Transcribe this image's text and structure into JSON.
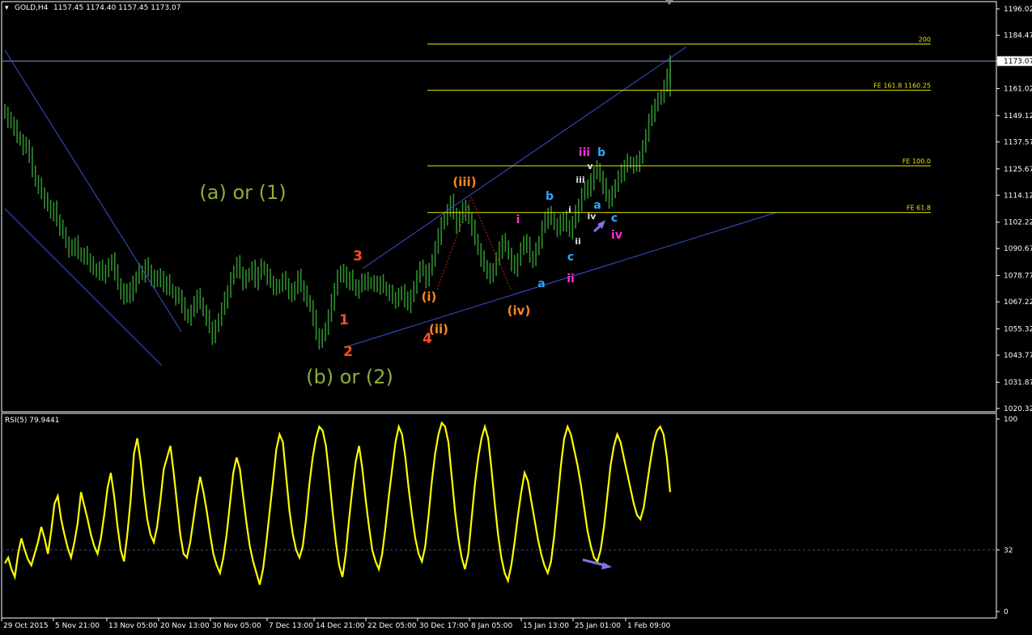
{
  "header": {
    "symbol": "GOLD,H4",
    "ohlc": "1157.45 1174.40 1157.45 1173.07",
    "rsi_label": "RSI(5) 79.9441"
  },
  "colors": {
    "background": "#000000",
    "frame": "#ffffff",
    "candles": "#2f8f2f",
    "channel": "#3a4fd6",
    "fib": "#e6e600",
    "rsi": "#ffff00",
    "price_line": "#8088b8",
    "arrow": "#7b77e6"
  },
  "chart_data": [
    {
      "type": "line",
      "name": "price",
      "y_ticks": [
        "1196.02",
        "1184.47",
        "1173.07",
        "1161.02",
        "1149.12",
        "1137.57",
        "1125.67",
        "1114.12",
        "1102.22",
        "1090.67",
        "1078.77",
        "1067.22",
        "1055.32",
        "1043.77",
        "1031.87",
        "1020.32"
      ],
      "ylim": [
        1020.32,
        1196.02
      ],
      "x_ticks": [
        "29 Oct 2015",
        "5 Nov 21:00",
        "13 Nov 05:00",
        "20 Nov 13:00",
        "30 Nov 05:00",
        "7 Dec 13:00",
        "14 Dec 21:00",
        "22 Dec 05:00",
        "30 Dec 17:00",
        "8 Jan 05:00",
        "15 Jan 13:00",
        "25 Jan 01:00",
        "1 Feb 09:00"
      ],
      "current_price": 1173.07,
      "close": [
        1150,
        1147,
        1146,
        1144,
        1140,
        1138,
        1135,
        1136,
        1132,
        1125,
        1120,
        1118,
        1115,
        1112,
        1110,
        1106,
        1108,
        1103,
        1100,
        1098,
        1093,
        1090,
        1091,
        1093,
        1089,
        1087,
        1088,
        1086,
        1084,
        1082,
        1080,
        1082,
        1079,
        1081,
        1083,
        1086,
        1080,
        1075,
        1072,
        1069,
        1073,
        1070,
        1075,
        1078,
        1081,
        1079,
        1083,
        1081,
        1078,
        1076,
        1079,
        1077,
        1074,
        1076,
        1073,
        1071,
        1069,
        1070,
        1066,
        1062,
        1060,
        1063,
        1066,
        1070,
        1067,
        1063,
        1060,
        1056,
        1052,
        1056,
        1060,
        1064,
        1068,
        1072,
        1077,
        1081,
        1084,
        1080,
        1076,
        1078,
        1080,
        1082,
        1076,
        1080,
        1083,
        1081,
        1078,
        1076,
        1074,
        1073,
        1075,
        1077,
        1075,
        1072,
        1070,
        1074,
        1078,
        1074,
        1071,
        1068,
        1065,
        1060,
        1053,
        1050,
        1052,
        1056,
        1061,
        1067,
        1073,
        1078,
        1081,
        1079,
        1076,
        1078,
        1075,
        1072,
        1074,
        1076,
        1077,
        1075,
        1076,
        1075,
        1074,
        1076,
        1074,
        1072,
        1071,
        1069,
        1068,
        1070,
        1072,
        1068,
        1066,
        1070,
        1073,
        1079,
        1082,
        1081,
        1077,
        1081,
        1086,
        1091,
        1096,
        1102,
        1103,
        1108,
        1111,
        1106,
        1101,
        1104,
        1109,
        1106,
        1104,
        1100,
        1095,
        1090,
        1086,
        1083,
        1081,
        1078,
        1082,
        1086,
        1090,
        1094,
        1092,
        1088,
        1084,
        1082,
        1086,
        1090,
        1094,
        1092,
        1087,
        1086,
        1090,
        1094,
        1100,
        1103,
        1106,
        1104,
        1101,
        1099,
        1102,
        1104,
        1101,
        1098,
        1102,
        1106,
        1110,
        1114,
        1118,
        1116,
        1120,
        1124,
        1126,
        1122,
        1118,
        1114,
        1112,
        1115,
        1119,
        1122,
        1124,
        1127,
        1129,
        1128,
        1127,
        1128,
        1131,
        1135,
        1141,
        1147,
        1150,
        1154,
        1156,
        1158,
        1162,
        1166,
        1173.07
      ]
    },
    {
      "type": "line",
      "name": "RSI(5)",
      "ylim": [
        0,
        100
      ],
      "y_ticks": [
        "100",
        "32",
        "0"
      ],
      "level": 32,
      "values": [
        25,
        28,
        22,
        18,
        30,
        38,
        32,
        27,
        24,
        30,
        36,
        44,
        38,
        30,
        42,
        56,
        60,
        48,
        40,
        33,
        28,
        36,
        46,
        62,
        55,
        48,
        40,
        34,
        30,
        38,
        50,
        64,
        72,
        60,
        45,
        32,
        26,
        40,
        58,
        82,
        90,
        78,
        62,
        48,
        40,
        36,
        44,
        58,
        74,
        80,
        86,
        72,
        56,
        40,
        30,
        28,
        36,
        48,
        60,
        70,
        62,
        52,
        40,
        30,
        24,
        20,
        28,
        40,
        56,
        72,
        80,
        74,
        60,
        46,
        34,
        26,
        20,
        14,
        22,
        36,
        52,
        68,
        84,
        92,
        88,
        70,
        52,
        40,
        32,
        28,
        34,
        48,
        66,
        80,
        90,
        96,
        94,
        86,
        70,
        52,
        36,
        24,
        18,
        30,
        48,
        64,
        78,
        86,
        74,
        58,
        44,
        32,
        26,
        22,
        30,
        44,
        60,
        74,
        88,
        96,
        92,
        80,
        64,
        50,
        38,
        30,
        26,
        34,
        50,
        68,
        82,
        92,
        98,
        96,
        88,
        70,
        52,
        38,
        28,
        22,
        30,
        48,
        66,
        80,
        90,
        96,
        90,
        74,
        56,
        40,
        28,
        20,
        16,
        24,
        36,
        50,
        62,
        72,
        68,
        58,
        48,
        38,
        30,
        24,
        20,
        26,
        40,
        58,
        76,
        90,
        96,
        92,
        84,
        76,
        66,
        54,
        42,
        34,
        28,
        26,
        32,
        44,
        60,
        76,
        86,
        92,
        88,
        80,
        72,
        64,
        56,
        50,
        48,
        54,
        66,
        78,
        88,
        94,
        96,
        92,
        80,
        62
      ]
    }
  ],
  "levels": [
    {
      "label": "200",
      "value": 1180.6
    },
    {
      "label": "FE 161.8 1160.25",
      "value": 1160.25
    },
    {
      "label": "FE 100.0",
      "value": 1127.0
    },
    {
      "label": "FE 61.8",
      "value": 1106.5
    }
  ],
  "annotations": [
    {
      "text": "(a) or (1)",
      "color": "#8fae3a",
      "size": "big"
    },
    {
      "text": "(b) or (2)",
      "color": "#8fae3a",
      "size": "big"
    },
    {
      "text": "1",
      "color": "#ff4e1e"
    },
    {
      "text": "2",
      "color": "#ff4e1e"
    },
    {
      "text": "3",
      "color": "#ff4e1e"
    },
    {
      "text": "4",
      "color": "#ff4e1e"
    },
    {
      "text": "(i)",
      "color": "#ff8a1e"
    },
    {
      "text": "(ii)",
      "color": "#ff8a1e"
    },
    {
      "text": "(iii)",
      "color": "#ff8a1e"
    },
    {
      "text": "(iv)",
      "color": "#ff8a1e"
    },
    {
      "text": "i",
      "color": "#ff2fd6"
    },
    {
      "text": "ii",
      "color": "#ff2fd6"
    },
    {
      "text": "iii",
      "color": "#ff2fd6"
    },
    {
      "text": "iv",
      "color": "#ff2fd6"
    },
    {
      "text": "a",
      "color": "#2aa8ff"
    },
    {
      "text": "b",
      "color": "#2aa8ff"
    },
    {
      "text": "c",
      "color": "#2aa8ff"
    },
    {
      "text": "b",
      "color": "#2aa8ff"
    },
    {
      "text": "a",
      "color": "#2aa8ff"
    },
    {
      "text": "c",
      "color": "#2aa8ff"
    },
    {
      "text": "i",
      "color": "#dddddd"
    },
    {
      "text": "ii",
      "color": "#dddddd"
    },
    {
      "text": "iii",
      "color": "#dddddd"
    },
    {
      "text": "iv",
      "color": "#dddddd"
    },
    {
      "text": "v",
      "color": "#dddddd"
    }
  ]
}
